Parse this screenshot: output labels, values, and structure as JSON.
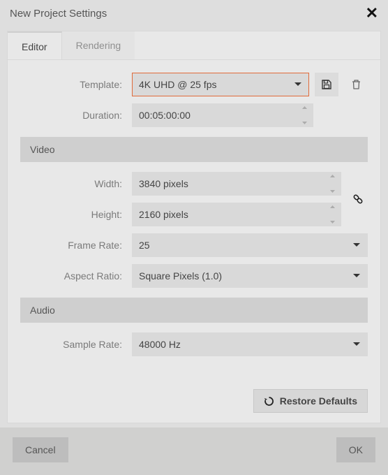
{
  "window": {
    "title": "New Project Settings"
  },
  "tabs": {
    "editor": "Editor",
    "rendering": "Rendering",
    "active": "editor"
  },
  "labels": {
    "template": "Template:",
    "duration": "Duration:",
    "video_section": "Video",
    "width": "Width:",
    "height": "Height:",
    "frame_rate": "Frame Rate:",
    "aspect_ratio": "Aspect Ratio:",
    "audio_section": "Audio",
    "sample_rate": "Sample Rate:"
  },
  "values": {
    "template": "4K UHD @ 25 fps",
    "duration": "00:05:00:00",
    "width": "3840 pixels",
    "height": "2160 pixels",
    "frame_rate": "25",
    "aspect_ratio": "Square Pixels (1.0)",
    "sample_rate": "48000 Hz"
  },
  "buttons": {
    "restore": "Restore Defaults",
    "cancel": "Cancel",
    "ok": "OK"
  }
}
